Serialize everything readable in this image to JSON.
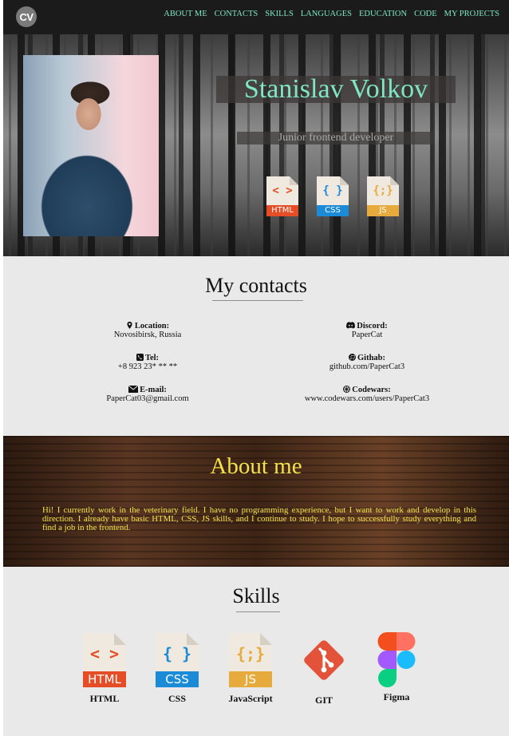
{
  "nav": {
    "logo": "CV",
    "items": [
      "ABOUT ME",
      "CONTACTS",
      "SKILLS",
      "LANGUAGES",
      "EDUCATION",
      "CODE",
      "MY PROJECTS"
    ]
  },
  "hero": {
    "name": "Stanislav Volkov",
    "role": "Junior frontend developer",
    "tech_icons": [
      {
        "symbol": "< >",
        "label": "HTML",
        "color": "#e44d26"
      },
      {
        "symbol": "{ }",
        "label": "CSS",
        "color": "#1b8bd8"
      },
      {
        "symbol": "{;}",
        "label": "JS",
        "color": "#e6ab3c"
      }
    ]
  },
  "contacts": {
    "title": "My contacts",
    "left": [
      {
        "icon": "location-pin-icon",
        "label": "Location:",
        "value": "Novosibirsk, Russia"
      },
      {
        "icon": "phone-icon",
        "label": "Tel:",
        "value": "+8 923 23* ** **"
      },
      {
        "icon": "envelope-icon",
        "label": "E-mail:",
        "value": "PaperCat03@gmail.com"
      }
    ],
    "right": [
      {
        "icon": "discord-icon",
        "label": "Discord:",
        "value": "PaperCat"
      },
      {
        "icon": "github-icon",
        "label": "Githab:",
        "value": "github.com/PaperCat3"
      },
      {
        "icon": "codewars-icon",
        "label": "Codewars:",
        "value": "www.codewars.com/users/PaperCat3"
      }
    ]
  },
  "about": {
    "title": "About me",
    "text": "Hi! I currently work in the veterinary field. I have no programming experience, but I want to work and develop in this direction. I already have basic HTML, CSS, JS skills, and I continue to study. I hope to successfully study everything and find a job in the frontend."
  },
  "skills": {
    "title": "Skills",
    "items": [
      {
        "name": "HTML",
        "icon": "html-file-icon"
      },
      {
        "name": "CSS",
        "icon": "css-file-icon"
      },
      {
        "name": "JavaScript",
        "icon": "js-file-icon"
      },
      {
        "name": "GIT",
        "icon": "git-icon"
      },
      {
        "name": "Figma",
        "icon": "figma-icon"
      }
    ]
  },
  "colors": {
    "accent": "#7fe7c6",
    "about_text": "#f3e24b",
    "nav_bg": "#1b1b1b",
    "section_bg": "#e9e9e9",
    "git": "#e2533a"
  }
}
